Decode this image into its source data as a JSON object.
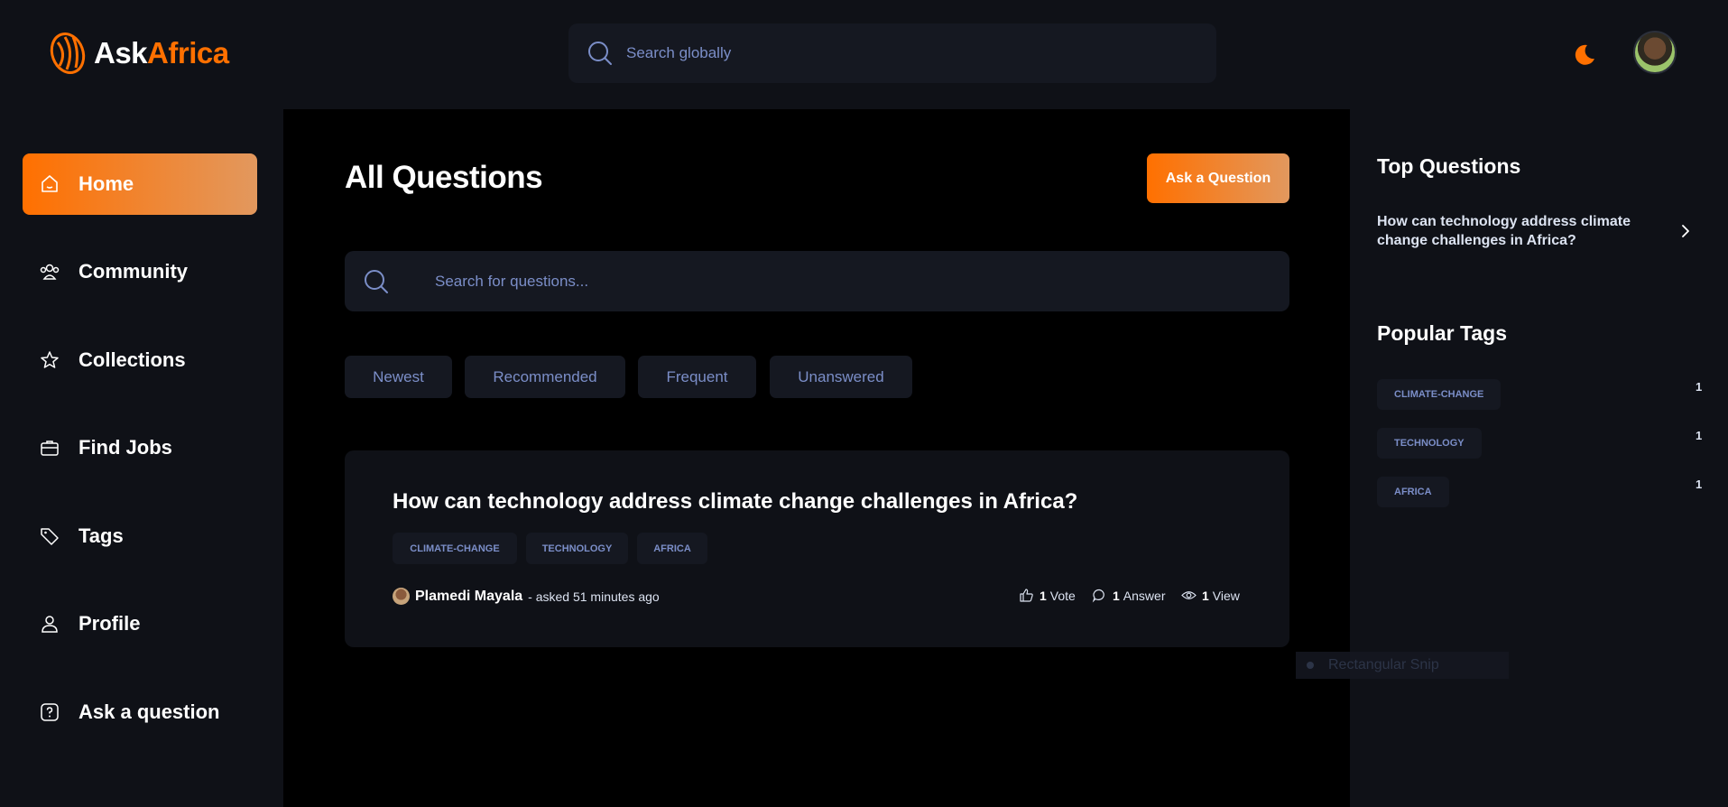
{
  "header": {
    "logo_part1": "Ask",
    "logo_part2": "Africa",
    "search_placeholder": "Search globally",
    "theme_icon": "moon-icon",
    "accent": "#ff7000"
  },
  "sidebar": {
    "items": [
      {
        "label": "Home",
        "icon": "home-icon",
        "active": true
      },
      {
        "label": "Community",
        "icon": "users-icon"
      },
      {
        "label": "Collections",
        "icon": "star-icon"
      },
      {
        "label": "Find Jobs",
        "icon": "briefcase-icon"
      },
      {
        "label": "Tags",
        "icon": "tag-icon"
      },
      {
        "label": "Profile",
        "icon": "user-icon"
      },
      {
        "label": "Ask a question",
        "icon": "question-icon"
      }
    ]
  },
  "main": {
    "title": "All Questions",
    "ask_button": "Ask a Question",
    "search_placeholder": "Search for questions...",
    "filters": [
      "Newest",
      "Recommended",
      "Frequent",
      "Unanswered"
    ],
    "questions": [
      {
        "title": "How can technology address climate change challenges in Africa?",
        "tags": [
          "CLIMATE-CHANGE",
          "TECHNOLOGY",
          "AFRICA"
        ],
        "author": "Plamedi Mayala",
        "asked": "- asked 51 minutes ago",
        "votes_num": "1",
        "votes_label": "Vote",
        "answers_num": "1",
        "answers_label": "Answer",
        "views_num": "1",
        "views_label": "View"
      }
    ]
  },
  "rightbar": {
    "top_questions_heading": "Top Questions",
    "top_questions": [
      "How can technology address climate change challenges in Africa?"
    ],
    "popular_tags_heading": "Popular Tags",
    "popular_tags": [
      {
        "name": "CLIMATE-CHANGE",
        "count": "1"
      },
      {
        "name": "TECHNOLOGY",
        "count": "1"
      },
      {
        "name": "AFRICA",
        "count": "1"
      }
    ]
  },
  "overlay": {
    "snip_label": "Rectangular Snip"
  }
}
